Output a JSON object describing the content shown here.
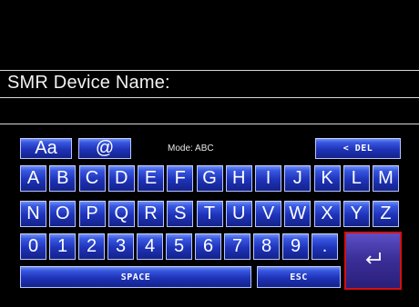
{
  "device_name_label": "SMR Device Name:",
  "device_name_value": "",
  "mode_text": "Mode: ABC",
  "top_keys": {
    "case": "Aa",
    "at": "@",
    "delete": "< DEL"
  },
  "row1": [
    "A",
    "B",
    "C",
    "D",
    "E",
    "F",
    "G",
    "H",
    "I",
    "J",
    "K",
    "L",
    "M"
  ],
  "row2": [
    "N",
    "O",
    "P",
    "Q",
    "R",
    "S",
    "T",
    "U",
    "V",
    "W",
    "X",
    "Y",
    "Z"
  ],
  "row3": [
    "0",
    "1",
    "2",
    "3",
    "4",
    "5",
    "6",
    "7",
    "8",
    "9",
    "."
  ],
  "bottom_keys": {
    "space": "SPACE",
    "esc": "ESC"
  },
  "enter_icon": "return-arrow-icon",
  "colors": {
    "key_blue": "#1e33b8",
    "enter_border": "#d41010",
    "background": "#000000"
  }
}
